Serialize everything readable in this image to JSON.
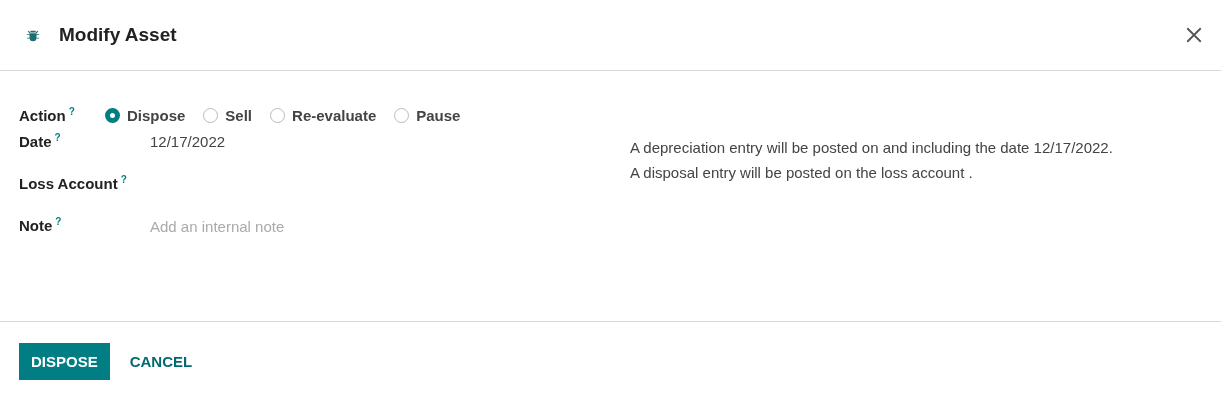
{
  "dialog": {
    "title": "Modify Asset"
  },
  "action": {
    "label": "Action",
    "help": "?",
    "options": [
      {
        "label": "Dispose",
        "selected": true
      },
      {
        "label": "Sell",
        "selected": false
      },
      {
        "label": "Re-evaluate",
        "selected": false
      },
      {
        "label": "Pause",
        "selected": false
      }
    ]
  },
  "fields": [
    {
      "label": "Date",
      "help": "?",
      "value": "12/17/2022"
    },
    {
      "label": "Loss Account",
      "help": "?"
    },
    {
      "label": "Note",
      "help": "?",
      "placeholder": "Add an internal note"
    }
  ],
  "info": [
    "A depreciation entry will be posted on and including the date 12/17/2022.",
    "A disposal entry will be posted on the loss account ."
  ],
  "buttons": [
    {
      "label": "DISPOSE",
      "kind": "primary"
    },
    {
      "label": "CANCEL",
      "kind": "link"
    }
  ]
}
